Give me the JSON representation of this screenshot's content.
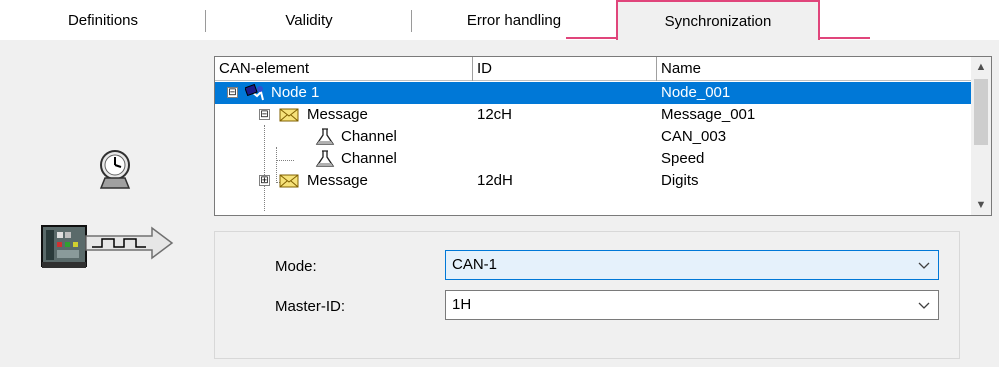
{
  "tabs": [
    {
      "label": "Definitions"
    },
    {
      "label": "Validity"
    },
    {
      "label": "Error handling"
    },
    {
      "label": "Synchronization",
      "active": true
    }
  ],
  "accent_color": "#e0457b",
  "selection_color": "#0078d7",
  "grid": {
    "columns": [
      "CAN-element",
      "ID",
      "Name"
    ],
    "rows": [
      {
        "element": "Node 1",
        "id": "",
        "name": "Node_001",
        "icon": "node-icon",
        "expander": "⊟",
        "selected": true
      },
      {
        "element": "Message",
        "id": "12cH",
        "name": "Message_001",
        "icon": "envelope-icon",
        "expander": "⊟"
      },
      {
        "element": "Channel",
        "id": "",
        "name": "CAN_003",
        "icon": "flask-icon"
      },
      {
        "element": "Channel",
        "id": "",
        "name": "Speed",
        "icon": "flask-icon"
      },
      {
        "element": "Message",
        "id": "12dH",
        "name": "Digits",
        "icon": "envelope-icon",
        "expander": "⊞"
      }
    ]
  },
  "form": {
    "mode_label": "Mode:",
    "mode_value": "CAN-1",
    "master_label": "Master-ID:",
    "master_value": "1H"
  }
}
